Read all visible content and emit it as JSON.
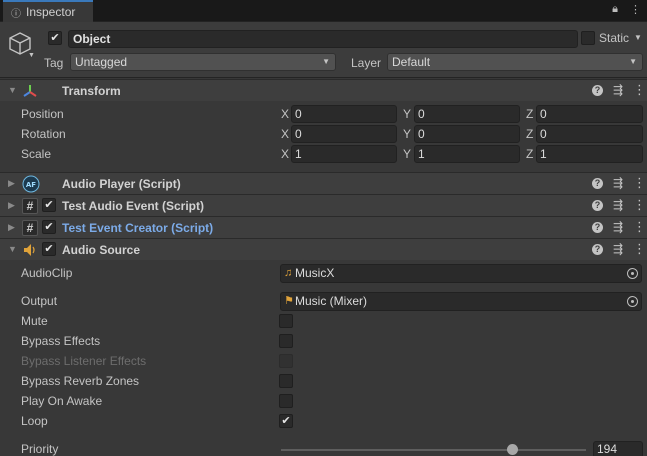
{
  "tab": {
    "title": "Inspector"
  },
  "header": {
    "object_name": "Object",
    "active_checked": true,
    "static_label": "Static",
    "static_checked": false,
    "tag_label": "Tag",
    "tag_value": "Untagged",
    "layer_label": "Layer",
    "layer_value": "Default"
  },
  "components": {
    "transform": {
      "title": "Transform",
      "rows": [
        {
          "label": "Position",
          "x": "0",
          "y": "0",
          "z": "0"
        },
        {
          "label": "Rotation",
          "x": "0",
          "y": "0",
          "z": "0"
        },
        {
          "label": "Scale",
          "x": "1",
          "y": "1",
          "z": "1"
        }
      ],
      "axes": {
        "x": "X",
        "y": "Y",
        "z": "Z"
      }
    },
    "audio_player": {
      "title": "Audio Player (Script)"
    },
    "test_audio_event": {
      "title": "Test Audio Event (Script)"
    },
    "test_event_creator": {
      "title": "Test Event Creator (Script)"
    },
    "audio_source": {
      "title": "Audio Source",
      "audioclip_label": "AudioClip",
      "audioclip_value": "MusicX",
      "output_label": "Output",
      "output_value": "Music (Mixer)",
      "mute_label": "Mute",
      "mute_checked": false,
      "bypass_effects_label": "Bypass Effects",
      "bypass_effects_checked": false,
      "bypass_listener_label": "Bypass Listener Effects",
      "bypass_listener_checked": false,
      "bypass_reverb_label": "Bypass Reverb Zones",
      "bypass_reverb_checked": false,
      "play_on_awake_label": "Play On Awake",
      "play_on_awake_checked": false,
      "loop_label": "Loop",
      "loop_checked": true,
      "priority_label": "Priority",
      "priority_value": "194",
      "priority_fraction": 0.76
    }
  },
  "colors": {
    "accent": "#3a79bb",
    "script_link": "#7cabe8",
    "audio_icon": "#e0a33a"
  }
}
